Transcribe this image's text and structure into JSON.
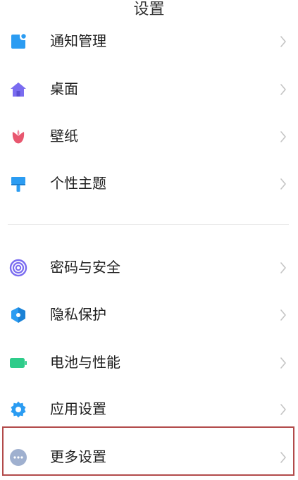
{
  "header": {
    "title": "设置"
  },
  "sections": [
    {
      "items": [
        {
          "label": "通知管理",
          "icon": "notification-icon",
          "color": "#2b9cf2"
        },
        {
          "label": "桌面",
          "icon": "home-icon",
          "color": "#7a6cf0"
        },
        {
          "label": "壁纸",
          "icon": "tulip-icon",
          "color": "#e8576f"
        },
        {
          "label": "个性主题",
          "icon": "paintbrush-icon",
          "color": "#2b9cf2"
        }
      ]
    },
    {
      "items": [
        {
          "label": "密码与安全",
          "icon": "fingerprint-icon",
          "color": "#7a6cf0"
        },
        {
          "label": "隐私保护",
          "icon": "privacy-shield-icon",
          "color": "#2b9cf2"
        },
        {
          "label": "电池与性能",
          "icon": "battery-icon",
          "color": "#2ecc8a"
        },
        {
          "label": "应用设置",
          "icon": "gear-icon",
          "color": "#2b9cf2"
        },
        {
          "label": "更多设置",
          "icon": "more-dots-icon",
          "color": "#9fb0cf"
        }
      ]
    }
  ],
  "highlight": {
    "target": "更多设置",
    "color": "#b24a4a"
  }
}
